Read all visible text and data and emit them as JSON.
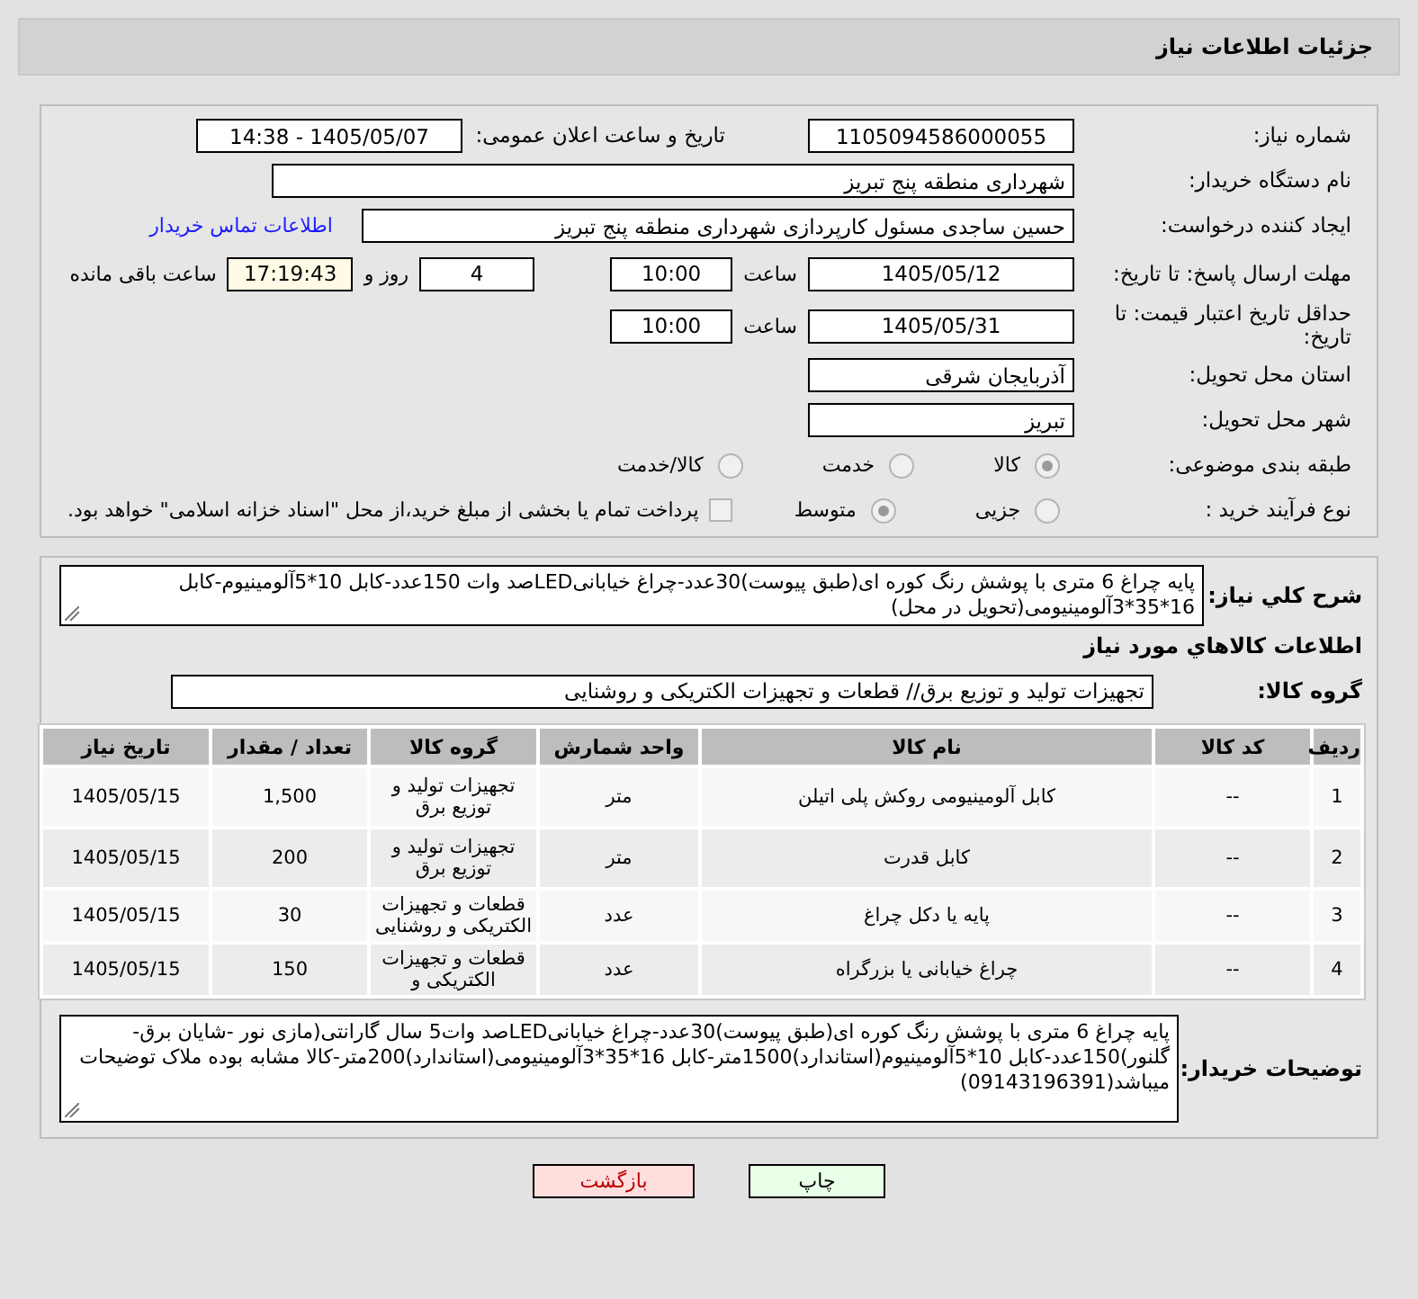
{
  "header": {
    "title": "جزئیات اطلاعات نیاز"
  },
  "need_number": {
    "label": "شماره نیاز:",
    "value": "1105094586000055"
  },
  "announce": {
    "label": "تاریخ و ساعت اعلان عمومی:",
    "value": "1405/05/07 - 14:38"
  },
  "buyer_org": {
    "label": "نام دستگاه خریدار:",
    "value": "شهرداری منطقه پنج تبریز"
  },
  "requester": {
    "label": "ایجاد کننده درخواست:",
    "value": "حسین ساجدی مسئول کارپردازی شهرداری منطقه پنج تبریز",
    "link": "اطلاعات تماس خریدار"
  },
  "response_deadline": {
    "label": "مهلت ارسال پاسخ: تا تاریخ:",
    "date": "1405/05/12",
    "time_label": "ساعت",
    "time": "10:00",
    "days": "4",
    "days_label": "روز و",
    "remaining": "17:19:43",
    "remaining_label": "ساعت باقی مانده"
  },
  "price_validity": {
    "label": "حداقل تاریخ اعتبار قیمت: تا تاریخ:",
    "date": "1405/05/31",
    "time_label": "ساعت",
    "time": "10:00"
  },
  "province": {
    "label": "استان محل تحویل:",
    "value": "آذربایجان شرقی"
  },
  "city": {
    "label": "شهر محل تحویل:",
    "value": "تبریز"
  },
  "category": {
    "label": "طبقه بندی موضوعی:",
    "options": [
      {
        "label": "کالا",
        "selected": true
      },
      {
        "label": "خدمت",
        "selected": false
      },
      {
        "label": "کالا/خدمت",
        "selected": false
      }
    ]
  },
  "process": {
    "label": "نوع فرآیند خرید :",
    "options": [
      {
        "label": "جزیی",
        "selected": false
      },
      {
        "label": "متوسط",
        "selected": true
      }
    ],
    "payment": {
      "checked": false,
      "text": "پرداخت تمام یا بخشی از مبلغ خرید،از محل \"اسناد خزانه اسلامی\" خواهد بود."
    }
  },
  "description": {
    "label": "شرح کلي نیاز:",
    "value": "پایه چراغ 6 متری با پوشش رنگ کوره ای(طبق پیوست)30عدد-چراغ خیابانیLEDصد وات 150عدد-کابل 10*5آلومینیوم-کابل 16*35*3آلومینیومی(تحویل در محل)"
  },
  "goods_heading": "اطلاعات کالاهاي مورد نیاز",
  "goods_group": {
    "label": "گروه کالا:",
    "value": "تجهیزات تولید و توزیع برق// قطعات و تجهیزات الکتریکی و روشنایی"
  },
  "table": {
    "columns": [
      "ردیف",
      "کد کالا",
      "نام کالا",
      "واحد شمارش",
      "گروه کالا",
      "تعداد / مقدار",
      "تاریخ نیاز"
    ],
    "rows": [
      [
        "1",
        "--",
        "کابل آلومینیومی روکش پلی اتیلن",
        "متر",
        "تجهیزات تولید و توزیع برق",
        "1,500",
        "1405/05/15"
      ],
      [
        "2",
        "--",
        "کابل قدرت",
        "متر",
        "تجهیزات تولید و توزیع برق",
        "200",
        "1405/05/15"
      ],
      [
        "3",
        "--",
        "پایه یا دکل چراغ",
        "عدد",
        "قطعات و تجهیزات الکتریکی و روشنایی",
        "30",
        "1405/05/15"
      ],
      [
        "4",
        "--",
        "چراغ خیابانی یا بزرگراه",
        "عدد",
        "قطعات و تجهیزات الکتریکی و",
        "150",
        "1405/05/15"
      ]
    ]
  },
  "buyer_notes": {
    "label": "توضیحات خریدار:",
    "value": "پایه چراغ 6 متری با پوشش رنگ کوره ای(طبق پیوست)30عدد-چراغ خیابانیLEDصد وات5 سال گارانتی(مازی نور -شایان برق-گلنور)150عدد-کابل 10*5آلومینیوم(استاندارد)1500متر-کابل 16*35*3آلومینیومی(استاندارد)200متر-کالا مشابه بوده ملاک توضیحات میباشد(09143196391)"
  },
  "buttons": [
    {
      "label": "چاپ",
      "kind": "print"
    },
    {
      "label": "بازگشت",
      "kind": "back"
    }
  ]
}
